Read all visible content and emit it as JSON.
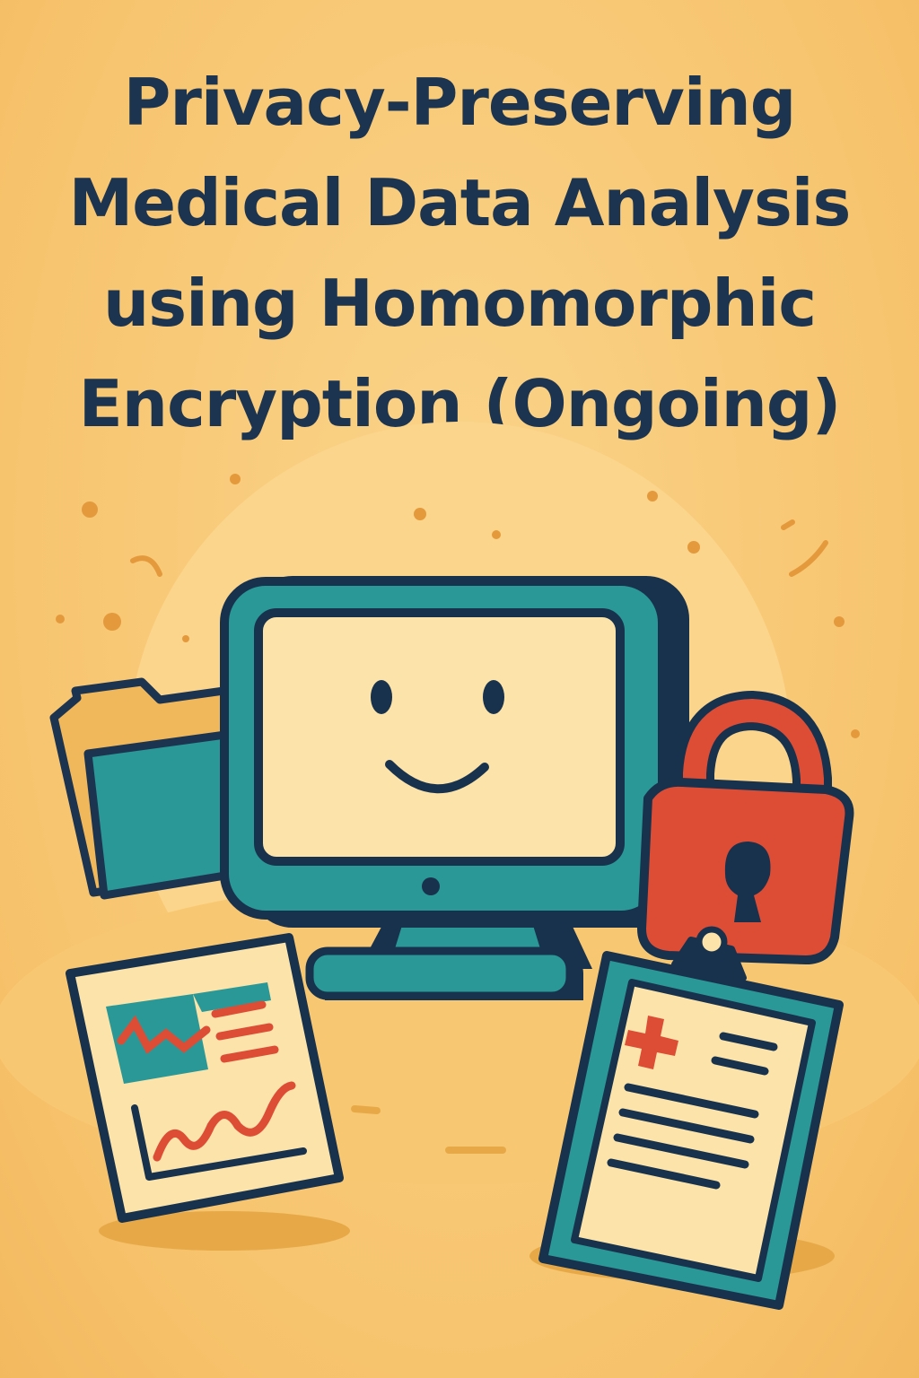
{
  "title": {
    "lines": [
      "Privacy-Preserving",
      "Medical Data Analysis",
      "using Homomorphic",
      "Encryption (Ongoing)"
    ]
  },
  "colors": {
    "background": "#f7c46e",
    "ink": "#1c3450",
    "teal": "#2a9897",
    "red": "#dd4d36",
    "folder": "#f0b85a",
    "paper": "#fbe3a9"
  },
  "icons": [
    "computer-monitor-icon",
    "smiley-face-icon",
    "folder-icon",
    "padlock-icon",
    "chart-report-icon",
    "medical-clipboard-icon"
  ]
}
